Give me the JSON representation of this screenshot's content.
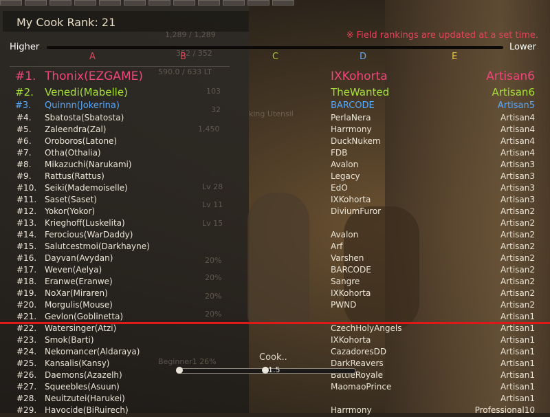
{
  "header": {
    "my_rank_label": "My Cook Rank: 21",
    "notice": "※ Field rankings are updated at a set time.",
    "higher": "Higher",
    "lower": "Lower"
  },
  "grades": [
    {
      "label": "A",
      "color": "#e0455a"
    },
    {
      "label": "B",
      "color": "#e0455a"
    },
    {
      "label": "C",
      "color": "#a9c53c"
    },
    {
      "label": "D",
      "color": "#6aa7e6"
    },
    {
      "label": "E",
      "color": "#e8c44a"
    }
  ],
  "colors": {
    "rank1": "#f0457a",
    "rank2": "#a6e13a",
    "rank3": "#55a8ff",
    "normal": "#ece6d7",
    "player_marker": "#e01818"
  },
  "ghost_text": [
    "1,289 / 1,289",
    "352 / 352",
    "590.0 / 633 LT",
    "103",
    "32",
    "1,450",
    "Lv 28",
    "Lv 11",
    "Lv 15",
    "20%",
    "20%",
    "20%",
    "20%",
    "king Utensil",
    "Beginner1  26%"
  ],
  "rankings": [
    {
      "rank": "#1.",
      "name": "Thonix(EZGAME)",
      "guild": "IXKohorta",
      "title": "Artisan6"
    },
    {
      "rank": "#2.",
      "name": "Venedi(Mabelle)",
      "guild": "TheWanted",
      "title": "Artisan6"
    },
    {
      "rank": "#3.",
      "name": "Quinnn(Jokerina)",
      "guild": "BARCODE",
      "title": "Artisan5"
    },
    {
      "rank": "#4.",
      "name": "Sbatosta(Sbatosta)",
      "guild": "PerlaNera",
      "title": "Artisan4"
    },
    {
      "rank": "#5.",
      "name": "Zaleendra(Zal)",
      "guild": "Harrmony",
      "title": "Artisan4"
    },
    {
      "rank": "#6.",
      "name": "Oroboros(Latone)",
      "guild": "DuckNukem",
      "title": "Artisan4"
    },
    {
      "rank": "#7.",
      "name": "Otha(Othalia)",
      "guild": "FDB",
      "title": "Artisan4"
    },
    {
      "rank": "#8.",
      "name": "Mikazuchi(Narukami)",
      "guild": "Avalon",
      "title": "Artisan3"
    },
    {
      "rank": "#9.",
      "name": "Rattus(Rattus)",
      "guild": "Legacy",
      "title": "Artisan3"
    },
    {
      "rank": "#10.",
      "name": "Seiki(Mademoiselle)",
      "guild": "EdO",
      "title": "Artisan3"
    },
    {
      "rank": "#11.",
      "name": "Saset(Saset)",
      "guild": "IXKohorta",
      "title": "Artisan3"
    },
    {
      "rank": "#12.",
      "name": "Yokor(Yokor)",
      "guild": "DiviumFuror",
      "title": "Artisan2"
    },
    {
      "rank": "#13.",
      "name": "Krieghoff(Luskelita)",
      "guild": "",
      "title": "Artisan2"
    },
    {
      "rank": "#14.",
      "name": "Ferocious(WarDaddy)",
      "guild": "Avalon",
      "title": "Artisan2"
    },
    {
      "rank": "#15.",
      "name": "Salutcestmoi(Darkhayne)",
      "guild": "Arf",
      "title": "Artisan2"
    },
    {
      "rank": "#16.",
      "name": "Dayvan(Avydan)",
      "guild": "Varshen",
      "title": "Artisan2"
    },
    {
      "rank": "#17.",
      "name": "Weven(Aelya)",
      "guild": "BARCODE",
      "title": "Artisan2"
    },
    {
      "rank": "#18.",
      "name": "Eranwe(Eranwe)",
      "guild": "Sangre",
      "title": "Artisan2"
    },
    {
      "rank": "#19.",
      "name": "NoXar(Miraren)",
      "guild": "IXKohorta",
      "title": "Artisan2"
    },
    {
      "rank": "#20.",
      "name": "Morgulis(Mouse)",
      "guild": "PWND",
      "title": "Artisan2"
    },
    {
      "rank": "#21.",
      "name": "Gevlon(Goblinetta)",
      "guild": "",
      "title": "Artisan1"
    },
    {
      "rank": "#22.",
      "name": "Watersinger(Atzi)",
      "guild": "CzechHolyAngels",
      "title": "Artisan1"
    },
    {
      "rank": "#23.",
      "name": "Smok(Barti)",
      "guild": "IXKohorta",
      "title": "Artisan1"
    },
    {
      "rank": "#24.",
      "name": "Nekomancer(Aldaraya)",
      "guild": "CazadoresDD",
      "title": "Artisan1"
    },
    {
      "rank": "#25.",
      "name": "Kansalis(Kansy)",
      "guild": "DarkReavers",
      "title": "Artisan1"
    },
    {
      "rank": "#26.",
      "name": "Daemons(Azazelh)",
      "guild": "BattleRoyale",
      "title": "Artisan1"
    },
    {
      "rank": "#27.",
      "name": "Squeebles(Asuun)",
      "guild": "MaomaoPrince",
      "title": "Artisan1"
    },
    {
      "rank": "#28.",
      "name": "Neuitzutei(Harukei)",
      "guild": "",
      "title": "Artisan1"
    },
    {
      "rank": "#29.",
      "name": "Havocide(BiRuirech)",
      "guild": "Harrmony",
      "title": "Professional10"
    }
  ],
  "cook": {
    "label": "Cook..",
    "value": "1.5",
    "progress": 0.5
  }
}
